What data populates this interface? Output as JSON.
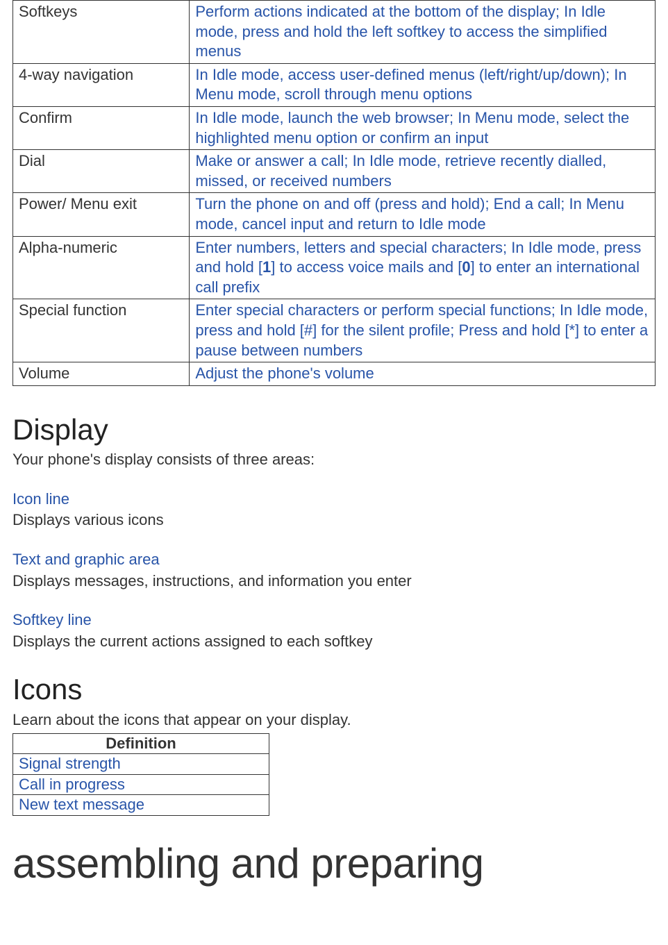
{
  "keys_table": {
    "rows": [
      {
        "name": "Softkeys",
        "desc": "Perform actions indicated at the bottom of the display; In Idle mode, press and hold the left softkey to access the simplified menus"
      },
      {
        "name": "4-way navigation",
        "desc": "In Idle mode, access user-defined menus (left/right/up/down); In Menu mode, scroll through menu options"
      },
      {
        "name": "Confirm",
        "desc": "In Idle mode, launch the web browser; In Menu mode, select the highlighted menu option or confirm an input"
      },
      {
        "name": "Dial",
        "desc": "Make or answer a call; In Idle mode, retrieve recently dialled, missed, or received numbers"
      },
      {
        "name": "Power/ Menu exit",
        "desc": "Turn the phone on and off (press and hold); End a call; In Menu mode, cancel input and return to Idle mode"
      },
      {
        "name": "Alpha-numeric",
        "desc_parts": {
          "p1": "Enter numbers, letters and special characters; In Idle mode, press and hold [",
          "em1": "1",
          "p2": "] to access voice mails and [",
          "em2": "0",
          "p3": "] to enter an international call prefix"
        }
      },
      {
        "name": "Special function",
        "desc": "Enter special characters or perform special functions; In Idle mode, press and hold [#] for the silent profile; Press and hold [*] to enter a pause between numbers"
      },
      {
        "name": "Volume",
        "desc": "Adjust the phone's volume"
      }
    ]
  },
  "display_section": {
    "title": "Display",
    "intro": "Your phone's display consists of three areas:",
    "items": [
      {
        "title": "Icon line",
        "desc": "Displays various icons"
      },
      {
        "title": "Text and graphic area",
        "desc": "Displays messages, instructions, and information you enter"
      },
      {
        "title": "Softkey line",
        "desc": "Displays the current actions assigned to each softkey"
      }
    ]
  },
  "icons_section": {
    "title": "Icons",
    "intro": "Learn about the icons that appear on your display.",
    "table_header": "Definition",
    "rows": [
      "Signal strength",
      "Call in progress",
      "New text message"
    ]
  },
  "big_heading": "assembling and preparing"
}
